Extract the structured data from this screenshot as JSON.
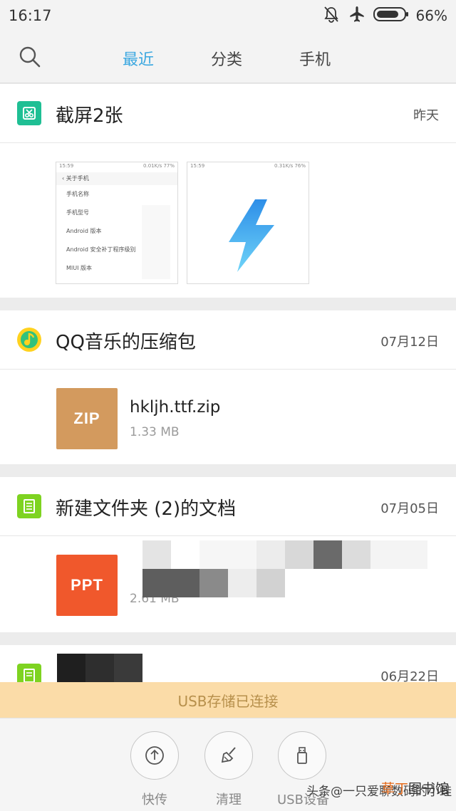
{
  "status_bar": {
    "time": "16:17",
    "battery": "66%"
  },
  "header": {
    "tabs": [
      {
        "label": "最近",
        "active": true
      },
      {
        "label": "分类",
        "active": false
      },
      {
        "label": "手机",
        "active": false
      }
    ]
  },
  "groups": [
    {
      "title": "截屏2张",
      "date": "昨天",
      "icon": "screenshot-icon",
      "screenshots": [
        {
          "status": "15:59",
          "status_right": "0.01K/s 77%",
          "header": "关于手机",
          "lines": [
            "手机名称",
            "手机型号",
            "Android 版本",
            "Android 安全补丁程序级别",
            "MIUI 版本"
          ]
        },
        {
          "status": "15:59",
          "status_right": "0.31K/s 76%"
        }
      ]
    },
    {
      "title": "QQ音乐的压缩包",
      "date": "07月12日",
      "icon": "qq-music-icon",
      "file": {
        "badge": "ZIP",
        "name": "hkljh.ttf.zip",
        "size": "1.33 MB"
      }
    },
    {
      "title": "新建文件夹 (2)的文档",
      "date": "07月05日",
      "icon": "document-icon",
      "file": {
        "badge": "PPT",
        "name": "",
        "size": "2.61 MB"
      }
    },
    {
      "title": "",
      "date": "06月22日",
      "icon": "document-icon"
    }
  ],
  "usb_banner": "USB存储已连接",
  "bottom_actions": [
    {
      "label": "快传",
      "icon": "upload-icon"
    },
    {
      "label": "清理",
      "icon": "broom-icon"
    },
    {
      "label": "USB设备",
      "icon": "usb-drive-icon"
    }
  ],
  "watermark": {
    "left": "头条@一只爱聊数码的小蛙",
    "brand_accent": "草丁",
    "brand_rest": "图书馆"
  },
  "colors": {
    "accent": "#3aa7e0",
    "zip": "#d39a5e",
    "ppt": "#f0582c",
    "doc": "#7ed321",
    "screenshot": "#1fbf94",
    "banner": "#fbdca8"
  }
}
